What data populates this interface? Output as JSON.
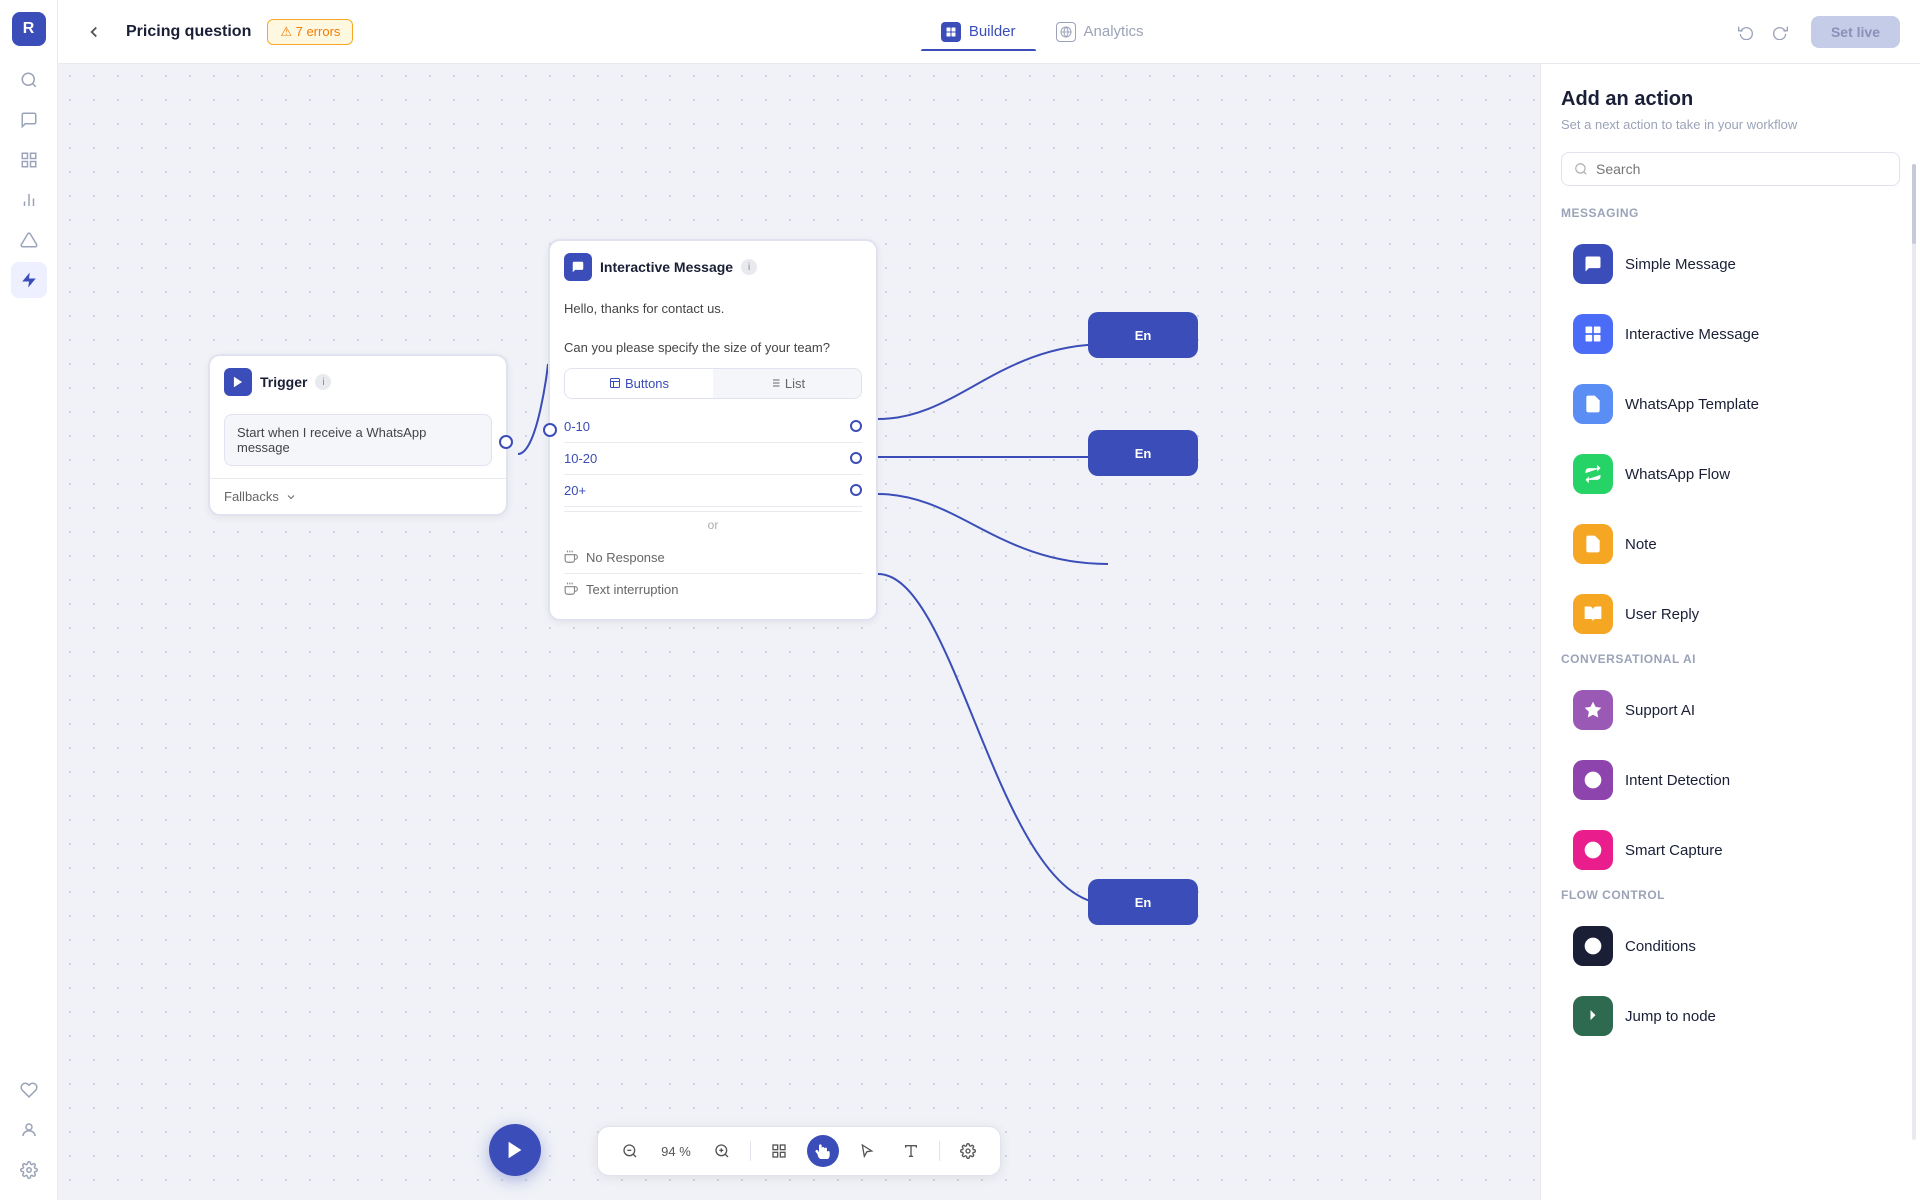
{
  "app": {
    "logo": "R",
    "page_title": "Pricing question",
    "errors_label": "⚠ 7 errors",
    "set_live_label": "Set live"
  },
  "tabs": [
    {
      "id": "builder",
      "label": "Builder",
      "active": true
    },
    {
      "id": "analytics",
      "label": "Analytics",
      "active": false
    }
  ],
  "toolbar": {
    "zoom": "94 %",
    "undo_label": "↺",
    "redo_label": "↻"
  },
  "trigger_node": {
    "title": "Trigger",
    "message": "Start when I receive a WhatsApp message",
    "fallbacks_label": "Fallbacks"
  },
  "interactive_node": {
    "title": "Interactive Message",
    "text1": "Hello, thanks for contact us.",
    "text2": "Can you please specify the size of your team?",
    "tab_buttons": "Buttons",
    "tab_list": "List",
    "options": [
      "0-10",
      "10-20",
      "20+"
    ],
    "or_label": "or",
    "fallbacks": [
      "No Response",
      "Text interruption"
    ]
  },
  "canvas_toolbar": {
    "zoom_out": "−",
    "zoom_pct": "94 %",
    "zoom_in": "+",
    "grid": "⊞",
    "cursor": "↖",
    "text": "T",
    "settings": "⚙"
  },
  "sidebar_icons": {
    "search": "🔍",
    "chat": "💬",
    "contacts": "👥",
    "chart": "📊",
    "alert": "⚡",
    "bolt": "⚡",
    "heart": "♡",
    "agent": "👤",
    "gear": "⚙"
  },
  "right_panel": {
    "title": "Add an action",
    "subtitle": "Set a next action to take in your workflow",
    "search_placeholder": "Search",
    "sections": [
      {
        "label": "Messaging",
        "items": [
          {
            "id": "simple-message",
            "label": "Simple Message",
            "icon_type": "blue-dark",
            "icon": "💬"
          },
          {
            "id": "interactive-message",
            "label": "Interactive Message",
            "icon_type": "blue",
            "icon": "⊞"
          },
          {
            "id": "whatsapp-template",
            "label": "WhatsApp Template",
            "icon_type": "blue-light",
            "icon": "📄"
          },
          {
            "id": "whatsapp-flow",
            "label": "WhatsApp Flow",
            "icon_type": "green",
            "icon": "⇄"
          },
          {
            "id": "note",
            "label": "Note",
            "icon_type": "orange",
            "icon": "📝"
          },
          {
            "id": "user-reply",
            "label": "User Reply",
            "icon_type": "orange-book",
            "icon": "📖"
          }
        ]
      },
      {
        "label": "Conversational AI",
        "items": [
          {
            "id": "support-ai",
            "label": "Support AI",
            "icon_type": "purple",
            "icon": "✦"
          },
          {
            "id": "intent-detection",
            "label": "Intent Detection",
            "icon_type": "purple-q",
            "icon": "?"
          },
          {
            "id": "smart-capture",
            "label": "Smart Capture",
            "icon_type": "pink",
            "icon": "⊕"
          }
        ]
      },
      {
        "label": "Flow Control",
        "items": [
          {
            "id": "conditions",
            "label": "Conditions",
            "icon_type": "dark",
            "icon": "⊗"
          },
          {
            "id": "jump-to-node",
            "label": "Jump to node",
            "icon_type": "dark-green",
            "icon": "↳"
          }
        ]
      }
    ]
  }
}
